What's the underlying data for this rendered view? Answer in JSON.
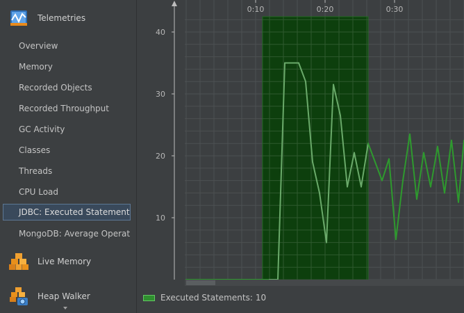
{
  "sidebar": {
    "telemetries": {
      "label": "Telemetries",
      "icon": "telemetries-icon"
    },
    "items": [
      {
        "label": "Overview"
      },
      {
        "label": "Memory"
      },
      {
        "label": "Recorded Objects"
      },
      {
        "label": "Recorded Throughput"
      },
      {
        "label": "GC Activity"
      },
      {
        "label": "Classes"
      },
      {
        "label": "Threads"
      },
      {
        "label": "CPU Load"
      },
      {
        "label": "JDBC: Executed Statements",
        "selected": true
      },
      {
        "label": "MongoDB: Average Operatio..."
      }
    ],
    "live_memory": {
      "label": "Live Memory",
      "icon": "live-memory-icon"
    },
    "heap_walker": {
      "label": "Heap Walker",
      "icon": "heap-walker-icon"
    }
  },
  "chart_data": {
    "type": "line",
    "x_tick_labels": [
      "0:10",
      "0:20",
      "0:30"
    ],
    "x_ticks_seconds": [
      10,
      20,
      30
    ],
    "y_tick_labels": [
      "10",
      "20",
      "30",
      "40"
    ],
    "y_ticks": [
      10,
      20,
      30,
      40
    ],
    "xlim_seconds": [
      0,
      40
    ],
    "ylim": [
      0,
      43
    ],
    "grid": true,
    "highlight_range_seconds": [
      11,
      26.2
    ],
    "series": [
      {
        "name": "Executed Statements",
        "x_seconds": [
          0,
          3,
          6,
          9,
          12,
          13.2,
          14.2,
          15.2,
          16.2,
          17.2,
          18.2,
          19.2,
          20.2,
          21.2,
          22.2,
          23.2,
          24.2,
          25.2,
          26.2,
          27.2,
          28.2,
          29.2,
          30.2,
          31.2,
          32.2,
          33.2,
          34.2,
          35.2,
          36.2,
          37.2,
          38.2,
          39.2,
          40
        ],
        "values": [
          0,
          0,
          0,
          0,
          0,
          0,
          35,
          35,
          35,
          32,
          19,
          14,
          6,
          31.5,
          26.5,
          15,
          20.5,
          15,
          22,
          19,
          16,
          19.5,
          6.5,
          16,
          23.5,
          13,
          20.5,
          15,
          21.5,
          14,
          22.5,
          12.5,
          22.5
        ]
      }
    ],
    "colors": {
      "highlight_fill": "#0d3f0d",
      "line_in_highlight": "#6aaa6a",
      "line_outside": "#2e9a2e",
      "grid": "#4d5052",
      "grid_in_highlight": "#2f5a2f"
    }
  },
  "legend": {
    "label": "Executed Statements:",
    "value": "10"
  }
}
